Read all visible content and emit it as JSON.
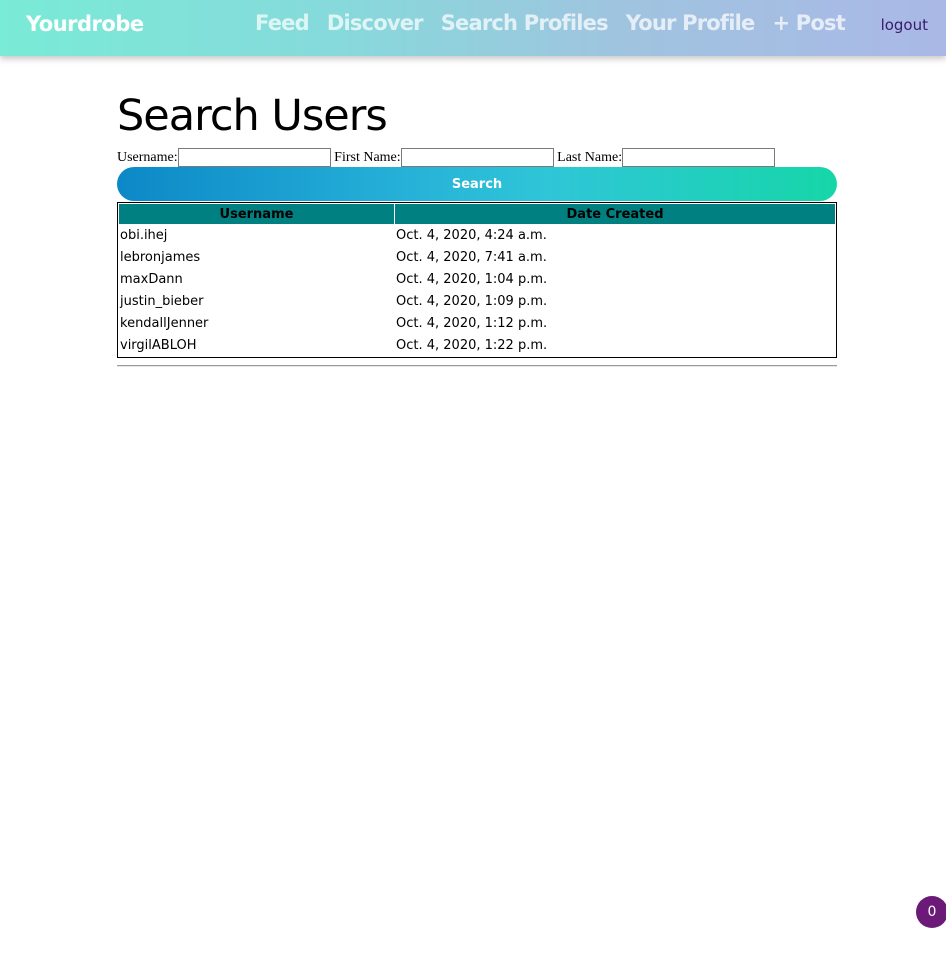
{
  "navbar": {
    "brand": "Yourdrobe",
    "links": [
      {
        "label": "Feed"
      },
      {
        "label": "Discover"
      },
      {
        "label": "Search Profiles"
      },
      {
        "label": "Your Profile"
      },
      {
        "label": "+ Post"
      }
    ],
    "logout": "logout"
  },
  "page": {
    "title": "Search Users"
  },
  "search_form": {
    "username_label": "Username:",
    "username_value": "",
    "first_name_label": "First Name:",
    "first_name_value": "",
    "last_name_label": "Last Name:",
    "last_name_value": "",
    "submit_label": "Search"
  },
  "results": {
    "columns": [
      "Username",
      "Date Created"
    ],
    "rows": [
      {
        "username": "obi.ihej",
        "date_created": "Oct. 4, 2020, 4:24 a.m."
      },
      {
        "username": "lebronjames",
        "date_created": "Oct. 4, 2020, 7:41 a.m."
      },
      {
        "username": "maxDann",
        "date_created": "Oct. 4, 2020, 1:04 p.m."
      },
      {
        "username": "justin_bieber",
        "date_created": "Oct. 4, 2020, 1:09 p.m."
      },
      {
        "username": "kendallJenner",
        "date_created": "Oct. 4, 2020, 1:12 p.m."
      },
      {
        "username": "virgilABLOH",
        "date_created": "Oct. 4, 2020, 1:22 p.m."
      }
    ]
  },
  "notification_badge": {
    "count": "0"
  },
  "colors": {
    "table_header": "#008080",
    "badge": "#6b1a78",
    "logout": "#3a1a6e"
  }
}
